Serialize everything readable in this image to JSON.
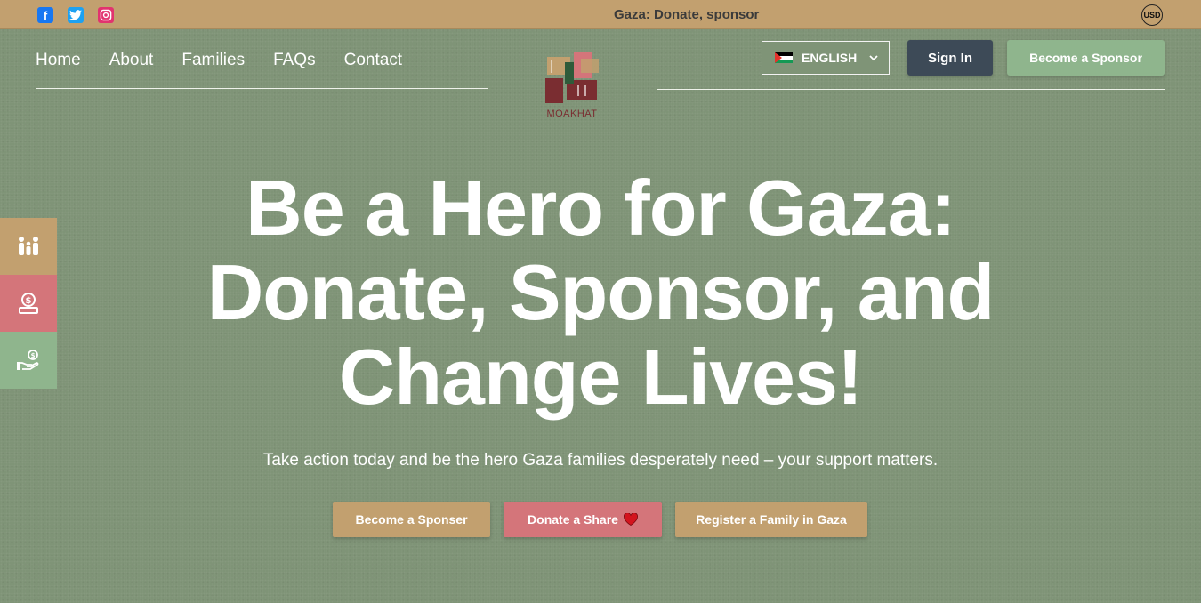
{
  "topbar": {
    "social": [
      {
        "name": "facebook",
        "glyph": "f"
      },
      {
        "name": "twitter",
        "glyph": "t"
      },
      {
        "name": "instagram",
        "glyph": "◎"
      }
    ],
    "ticker": "Gaza: Donate, sponsor",
    "currency": "USD"
  },
  "nav": {
    "items": [
      "Home",
      "About",
      "Families",
      "FAQs",
      "Contact"
    ]
  },
  "logo": {
    "text": "MOAKHAT",
    "colors": [
      "#c2a06f",
      "#7a2d31",
      "#8fb58d",
      "#d4757a",
      "#2f5b3a"
    ]
  },
  "header": {
    "language": "ENGLISH",
    "signin_label": "Sign In",
    "sponsor_label": "Become a Sponsor"
  },
  "side_buttons": [
    {
      "icon": "family-icon",
      "color": "#c2a06f"
    },
    {
      "icon": "donation-box-icon",
      "color": "#d4757a"
    },
    {
      "icon": "hand-coin-icon",
      "color": "#8fb58d"
    }
  ],
  "hero": {
    "title_lines": [
      "Be a Hero for Gaza:",
      "Donate, Sponsor, and",
      "Change Lives!"
    ],
    "subtitle": "Take action today and be the hero Gaza families desperately need – your support matters.",
    "buttons": {
      "sponsor": "Become a Sponser",
      "donate": "Donate a Share",
      "register": "Register a Family in Gaza"
    }
  },
  "colors": {
    "background": "#7f9477",
    "topbar": "#c2a06f",
    "tan": "#c2a06f",
    "rose": "#d4757a",
    "sage": "#8fb58d",
    "slate": "#3d4a57"
  }
}
